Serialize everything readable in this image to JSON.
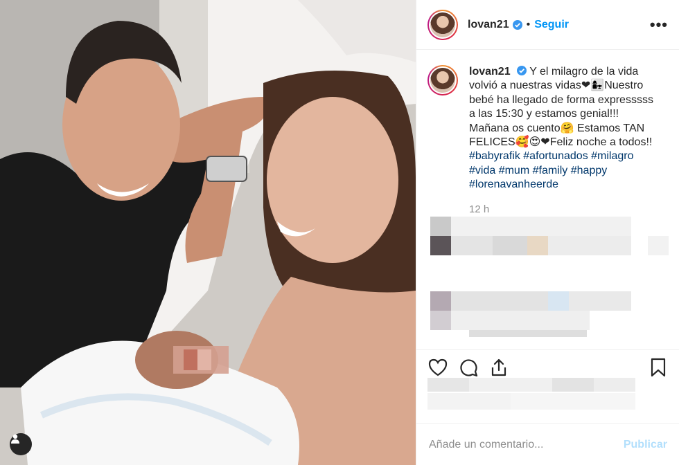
{
  "post": {
    "username": "lovan21",
    "verified": true,
    "follow_label": "Seguir",
    "separator": "•",
    "more_label": "•••"
  },
  "caption": {
    "username": "lovan21",
    "line1": "Y el milagro de la vida volvió a nuestras vidas❤👩‍👧Nuestro bebé ha llegado de forma expresssss a las 15:30 y estamos genial!!! Mañana os cuento🤗 Estamos TAN FELICES🥰😍❤Feliz noche a todos!! ",
    "hashtags": [
      "#babyrafik",
      "#afortunados",
      "#milagro",
      "#vida",
      "#mum",
      "#family",
      "#happy",
      "#lorenavanheerde"
    ],
    "time": "12 h"
  },
  "add_comment": {
    "placeholder": "Añade un comentario...",
    "publish_label": "Publicar"
  },
  "icons": [
    "like-icon",
    "comment-icon",
    "share-icon",
    "save-icon",
    "verified-icon",
    "user-tag-icon",
    "more-options-icon"
  ],
  "colors": {
    "link": "#0095f6",
    "hashtag": "#00376b",
    "muted": "#8e8e8e",
    "publish_disabled": "#b2dffc",
    "border": "#efefef"
  }
}
